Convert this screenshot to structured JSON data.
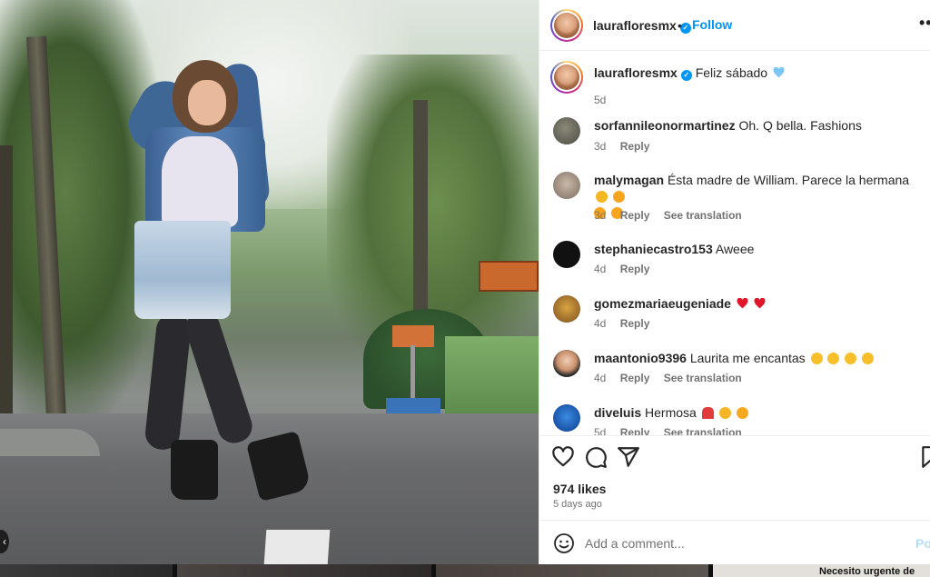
{
  "post": {
    "author": "laurafloresmx",
    "follow_label": "Follow",
    "more_label": "••",
    "verified_mark": "✓",
    "dot": "•",
    "caption": "Feliz sábado",
    "caption_emoji": "blue-heart",
    "caption_age": "5d",
    "likes": "974 likes",
    "posted": "5 days ago"
  },
  "comments": [
    {
      "user": "sorfannileonormartinez",
      "text": "Oh. Q bella. Fashions",
      "emojis": [],
      "emojis_line2": [],
      "age": "3d",
      "reply": "Reply",
      "translate": ""
    },
    {
      "user": "malymagan",
      "text": "Ésta madre de William. Parece la hermana",
      "emojis": [
        "astonished-face",
        "laughing-face"
      ],
      "emojis_line2": [
        "laughing-face",
        "laughing-face"
      ],
      "age": "3d",
      "reply": "Reply",
      "translate": "See translation"
    },
    {
      "user": "stephaniecastro153",
      "text": "Aweee",
      "emojis": [],
      "emojis_line2": [],
      "age": "4d",
      "reply": "Reply",
      "translate": ""
    },
    {
      "user": "gomezmariaeugeniade",
      "text": "",
      "emojis": [
        "red-heart",
        "red-heart"
      ],
      "emojis_line2": [],
      "age": "4d",
      "reply": "Reply",
      "translate": ""
    },
    {
      "user": "maantonio9396",
      "text": "Laurita me encantas",
      "emojis": [
        "heart-eyes-face",
        "heart-eyes-face",
        "heart-eyes-face",
        "heart-eyes-face"
      ],
      "emojis_line2": [],
      "age": "4d",
      "reply": "Reply",
      "translate": "See translation"
    },
    {
      "user": "diveluis",
      "text": "Hermosa",
      "emojis": [
        "rose",
        "hugging-face",
        "kiss-face"
      ],
      "emojis_line2": [],
      "age": "5d",
      "reply": "Reply",
      "translate": "See translation"
    }
  ],
  "composer": {
    "placeholder": "Add a comment...",
    "post_label": "Post"
  },
  "bottom_strip": {
    "text": "Necesito urgente de"
  },
  "colors": {
    "accent": "#0095f6",
    "text": "#262626",
    "muted": "#737373",
    "post_disabled": "#b2dffc"
  }
}
